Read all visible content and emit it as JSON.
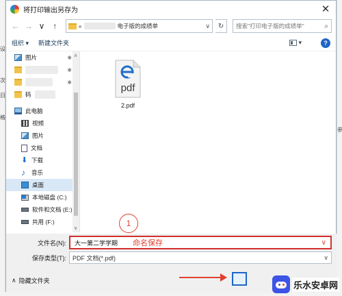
{
  "window": {
    "title": "将打印输出另存为",
    "close_glyph": "✕"
  },
  "navigation": {
    "back_glyph": "←",
    "forward_glyph": "→",
    "recent_glyph": "∨",
    "up_glyph": "↑",
    "address_prefix": "«",
    "address_current": "电子版的成绩单",
    "address_dropdown_glyph": "∨",
    "refresh_glyph": "↻",
    "search_placeholder": "搜索\"打印电子版的成绩单\"",
    "search_glyph": "⌕"
  },
  "toolbar": {
    "organize_label": "组织 ▾",
    "new_folder_label": "新建文件夹",
    "view_glyph": "▾",
    "help_label": "?"
  },
  "sidebar": {
    "items": [
      {
        "label": "图片",
        "icon": "pictures-icon",
        "pinned": true
      },
      {
        "label": "",
        "icon": "folder-icon",
        "pinned": true,
        "blurred": true
      },
      {
        "label": "",
        "icon": "folder-icon",
        "pinned": true,
        "blurred": true
      },
      {
        "label": "码",
        "icon": "folder-icon",
        "pinned": false,
        "blurred": true
      },
      {
        "label": "此电脑",
        "icon": "this-pc-icon"
      },
      {
        "label": "视频",
        "icon": "video-icon"
      },
      {
        "label": "图片",
        "icon": "pictures-icon"
      },
      {
        "label": "文档",
        "icon": "documents-icon"
      },
      {
        "label": "下载",
        "icon": "downloads-icon"
      },
      {
        "label": "音乐",
        "icon": "music-icon"
      },
      {
        "label": "桌面",
        "icon": "desktop-icon",
        "selected": true
      },
      {
        "label": "本地磁盘 (C:)",
        "icon": "local-disk-icon"
      },
      {
        "label": "软件和文档 (E:)",
        "icon": "drive-icon"
      },
      {
        "label": "共用 (F:)",
        "icon": "drive-icon"
      }
    ],
    "pin_glyph": "✱",
    "scroll_up": "∧",
    "scroll_down": "∨"
  },
  "files": [
    {
      "name": "2.pdf",
      "icon": "pdf-icon"
    }
  ],
  "form": {
    "filename_label": "文件名(N):",
    "filename_value": "大一第二学学期",
    "filename_annotation": "命名保存",
    "filename_dropdown": "∨",
    "type_label": "保存类型(T):",
    "type_value": "PDF 文档(*.pdf)",
    "type_dropdown": "∨"
  },
  "footer": {
    "hide_folders_label": "隐藏文件夹",
    "hide_folders_glyph": "∧"
  },
  "annotations": {
    "step_number": "1",
    "accent_color": "#e0402f"
  },
  "background": {
    "left_marks": [
      "设",
      "次",
      "日",
      "格"
    ],
    "right_mark": "参"
  },
  "watermark": {
    "text": "乐水安卓网"
  }
}
